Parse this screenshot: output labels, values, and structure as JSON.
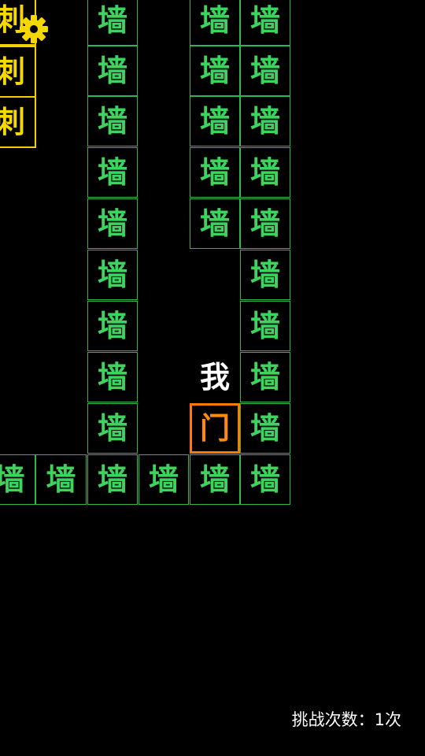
{
  "tiles": {
    "wall": "墙",
    "spike": "刺",
    "door": "门",
    "player": "我"
  },
  "colors": {
    "background": "#000000",
    "wall": "#3dd45e",
    "spike": "#f4d800",
    "door": "#ff8a10",
    "player": "#ffffff",
    "gear": "#f4d800"
  },
  "settings": {
    "icon": "gear-icon"
  },
  "status": {
    "attempts_label": "挑战次数：",
    "attempts_value": "1次"
  }
}
